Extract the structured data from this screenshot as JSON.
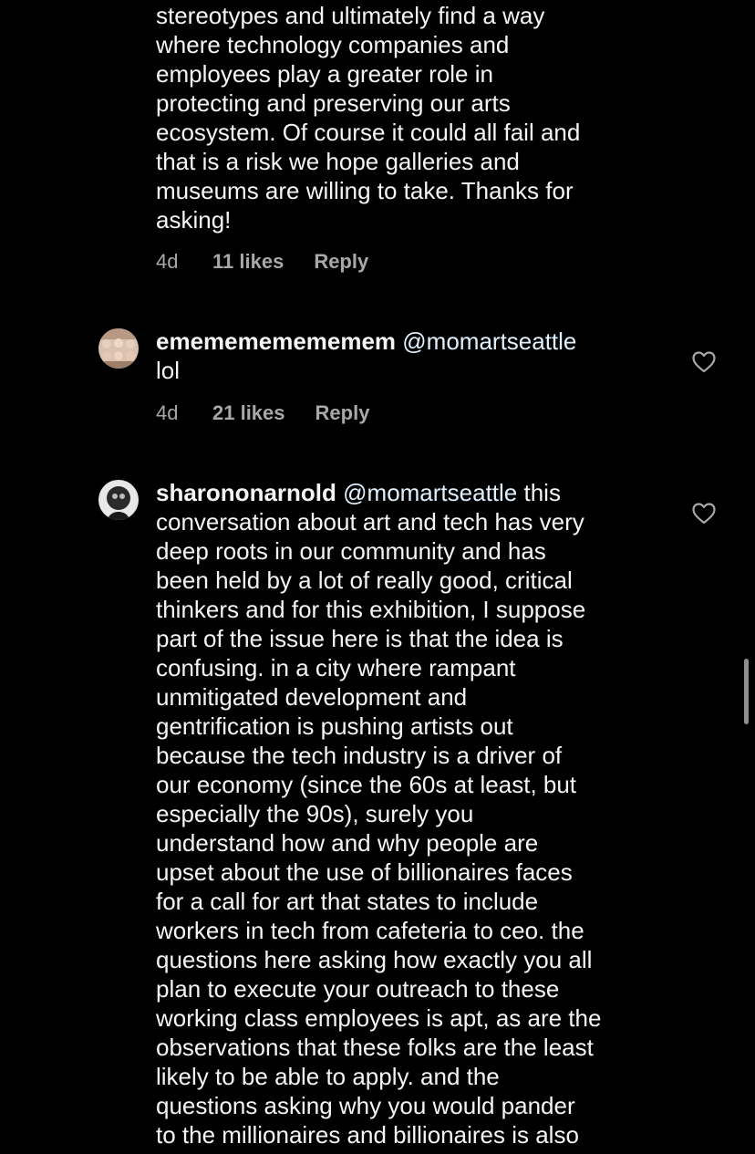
{
  "comments": [
    {
      "lines": [
        "stereotypes and ultimately find a way",
        "where technology companies and",
        "employees play a greater role in",
        "protecting and preserving our arts",
        "ecosystem. Of course it could all fail and",
        "that is a risk we hope galleries and",
        "museums are willing to take. Thanks for",
        "asking!"
      ],
      "time": "4d",
      "likes": "11 likes",
      "reply_label": "Reply"
    },
    {
      "username": "ememememememem",
      "mention": "@momartseattle",
      "lines": [
        "lol"
      ],
      "time": "4d",
      "likes": "21 likes",
      "reply_label": "Reply",
      "like_icon": "heart-outline-icon"
    },
    {
      "username": "sharononarnold",
      "mention": "@momartseattle",
      "first_line_rest": "this",
      "lines": [
        "conversation about art and tech has very",
        "deep roots in our community and has",
        "been held by a lot of really good, critical",
        "thinkers and for this exhibition, I suppose",
        "part of the issue here is that the idea is",
        "confusing. in a city where rampant",
        "unmitigated development and",
        "gentrification is pushing artists out",
        "because the tech industry is a driver of",
        "our economy (since the 60s at least, but",
        "especially the 90s), surely you",
        "understand how and why people are",
        "upset about the use of billionaires faces",
        "for a call for art that states to include",
        "workers in tech from cafeteria to ceo. the",
        "questions here asking how exactly you all",
        "plan to execute your outreach to these",
        "working class employees is apt, as are the",
        "observations that these folks are the least",
        "likely to be able to apply. and the",
        "questions asking why you would pander",
        "to the millionaires and billionaires is also"
      ],
      "like_icon": "heart-outline-icon"
    }
  ],
  "colors": {
    "background": "#000000",
    "text": "#f5f5f5",
    "meta": "#a8a8a8",
    "mention": "#e0f1ff"
  }
}
